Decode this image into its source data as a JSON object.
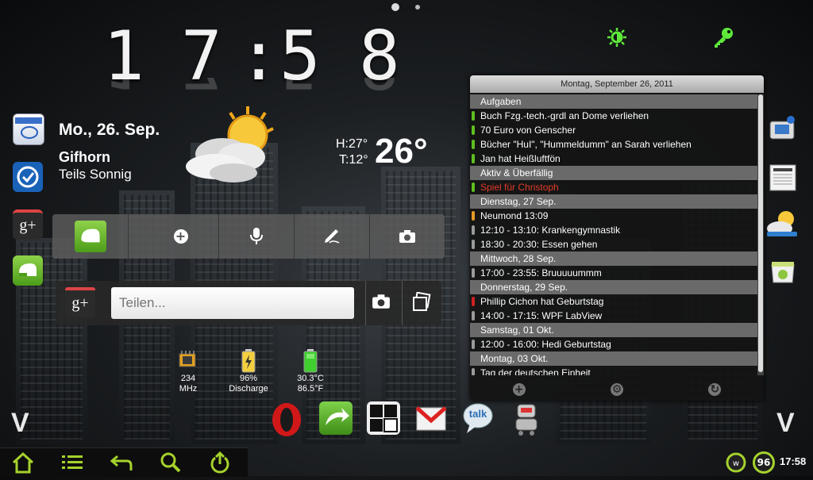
{
  "pager": {
    "pages": 2,
    "current": 1
  },
  "clock": {
    "h1": "1",
    "h2": "7",
    "sep": ":",
    "m1": "5",
    "m2": "8"
  },
  "date_weather": {
    "date": "Mo., 26. Sep.",
    "city": "Gifhorn",
    "condition": "Teils Sonnig",
    "high": "H:27°",
    "low": "T:12°",
    "current_temp": "26°"
  },
  "top_icons": [
    "brightness-icon",
    "key-icon"
  ],
  "left_dock": [
    "calendar-app-icon",
    "tasks-app-icon",
    "google-plus-app-icon",
    "evernote-app-icon"
  ],
  "right_dock": [
    "multimedia-app-icon",
    "news-app-icon",
    "weather-app-icon",
    "market-app-icon"
  ],
  "quick_bar": [
    "evernote-icon",
    "add-icon",
    "microphone-icon",
    "pen-icon",
    "camera-icon"
  ],
  "share": {
    "placeholder": "Teilen..."
  },
  "status_widgets": [
    {
      "line1": "234",
      "line2": "MHz"
    },
    {
      "line1": "96%",
      "line2": "Discharge"
    },
    {
      "line1": "30.3°C",
      "line2": "86.5°F"
    }
  ],
  "calendar": {
    "header": "Montag, September 26, 2011",
    "rows": [
      {
        "type": "sec",
        "text": "Aufgaben"
      },
      {
        "type": "ev",
        "color": "#5fbf1f",
        "text": "Buch Fzg.-tech.-grdl an Dome verliehen"
      },
      {
        "type": "ev",
        "color": "#5fbf1f",
        "text": "70 Euro von Genscher"
      },
      {
        "type": "ev",
        "color": "#5fbf1f",
        "text": "Bücher \"HuI\", \"Hummeldumm\" an Sarah verliehen"
      },
      {
        "type": "ev",
        "color": "#5fbf1f",
        "text": "Jan hat Heißluftfön"
      },
      {
        "type": "sec",
        "text": "Aktiv & Überfällig"
      },
      {
        "type": "ev",
        "color": "#5fbf1f",
        "text": "Spiel für Christoph",
        "text_color": "#e23b2b"
      },
      {
        "type": "sec",
        "text": "Dienstag, 27 Sep."
      },
      {
        "type": "ev",
        "color": "#e59a26",
        "text": "Neumond 13:09"
      },
      {
        "type": "ev",
        "color": "#9a9a9a",
        "text": "12:10 - 13:10: Krankengymnastik"
      },
      {
        "type": "ev",
        "color": "#9a9a9a",
        "text": "18:30 - 20:30: Essen gehen"
      },
      {
        "type": "sec",
        "text": "Mittwoch, 28 Sep."
      },
      {
        "type": "ev",
        "color": "#9a9a9a",
        "text": "17:00 - 23:55: Bruuuuummm"
      },
      {
        "type": "sec",
        "text": "Donnerstag, 29 Sep."
      },
      {
        "type": "ev",
        "color": "#d02020",
        "text": "Phillip Cichon hat Geburtstag"
      },
      {
        "type": "ev",
        "color": "#9a9a9a",
        "text": "14:00 - 17:15: WPF LabView"
      },
      {
        "type": "sec",
        "text": "Samstag, 01 Okt."
      },
      {
        "type": "ev",
        "color": "#9a9a9a",
        "text": "12:00 - 16:00: Hedi Geburtstag"
      },
      {
        "type": "sec",
        "text": "Montag, 03 Okt."
      },
      {
        "type": "ev",
        "color": "#9a9a9a",
        "text": "Tag der deutschen Einheit"
      }
    ]
  },
  "dock_apps": [
    "opera-icon",
    "wind-app-icon",
    "tiles-app-icon",
    "gmail-icon",
    "talk-icon",
    "robot-app-icon"
  ],
  "talk_label": "talk",
  "scroll_arrows": {
    "left": "V",
    "right": "V"
  },
  "status_bar": {
    "badge": "96",
    "time": "17:58"
  },
  "nav_buttons": [
    "home-icon",
    "menu-icon",
    "back-icon",
    "search-icon",
    "upload-icon"
  ],
  "colors": {
    "accent": "#a6d22c",
    "green_icon": "#5ee83a"
  }
}
